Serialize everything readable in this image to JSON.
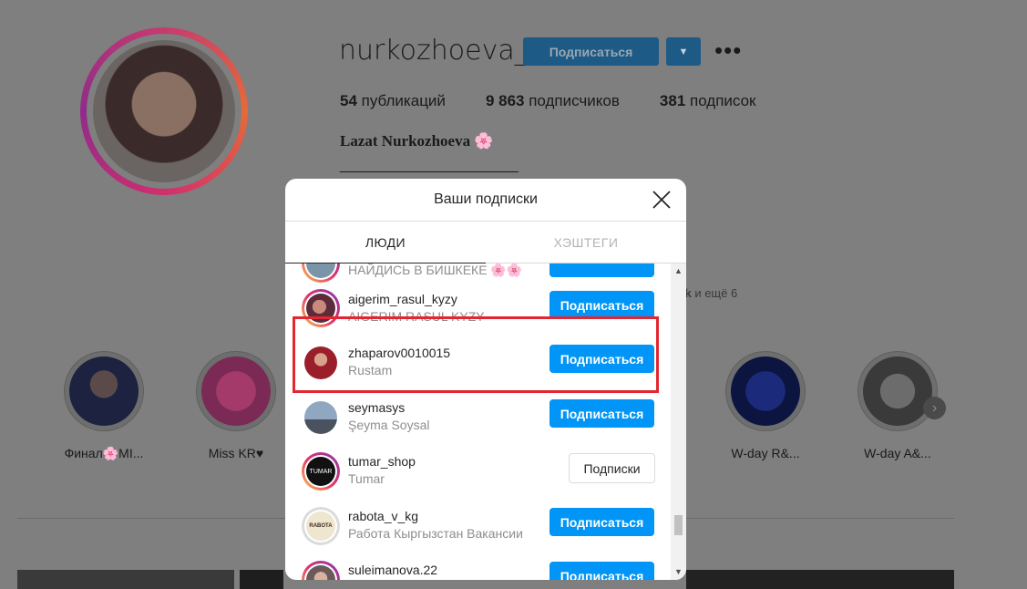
{
  "profile": {
    "username": "nurkozhoeva_",
    "follow_label": "Подписаться",
    "dropdown_icon": "chevron-down-icon",
    "more_icon": "•••",
    "stats": [
      {
        "count": "54",
        "label": " публикаций"
      },
      {
        "count": "9 863",
        "label": " подписчиков"
      },
      {
        "count": "381",
        "label": " подписок"
      }
    ],
    "full_name": "Lazat Nurkozhoeva 🌸",
    "bio_line": "______________________",
    "followed_by_partial": "kek",
    "followed_by_rest": " и ещё 6"
  },
  "highlights": [
    {
      "label": "Финал🌸MI..."
    },
    {
      "label": "Miss KR♥"
    },
    {
      "label": "W-day R&..."
    },
    {
      "label": "W-day A&..."
    }
  ],
  "highlights_next_icon": "›",
  "modal": {
    "title": "Ваши подписки",
    "close_icon": "close-icon",
    "tabs": [
      "ЛЮДИ",
      "ХЭШТЕГИ"
    ],
    "cut_top_text": "НАЙДИСЬ В БИШКЕКЕ 🌸🌸",
    "rows": [
      {
        "username": "aigerim_rasul_kyzy",
        "subtitle": "AIGERIM RASUL KYZY",
        "button": "Подписаться",
        "button_style": "blue"
      },
      {
        "username": "zhaparov0010015",
        "subtitle": "Rustam",
        "button": "Подписаться",
        "button_style": "blue"
      },
      {
        "username": "seymasys",
        "subtitle": "Şeyma Soysal",
        "button": "Подписаться",
        "button_style": "blue"
      },
      {
        "username": "tumar_shop",
        "subtitle": "Tumar",
        "button": "Подписки",
        "button_style": "white",
        "avatar_text": "TUMAR"
      },
      {
        "username": "rabota_v_kg",
        "subtitle": "Работа Кыргызстан Вакансии",
        "button": "Подписаться",
        "button_style": "blue",
        "avatar_text": "RABOTA"
      },
      {
        "username": "suleimanova.22",
        "subtitle": "",
        "button": "Подписаться",
        "button_style": "blue"
      }
    ],
    "scroll_up": "▲",
    "scroll_down": "▼"
  },
  "colors": {
    "accent_blue": "#0095f6",
    "highlight_box": "#e32631"
  }
}
